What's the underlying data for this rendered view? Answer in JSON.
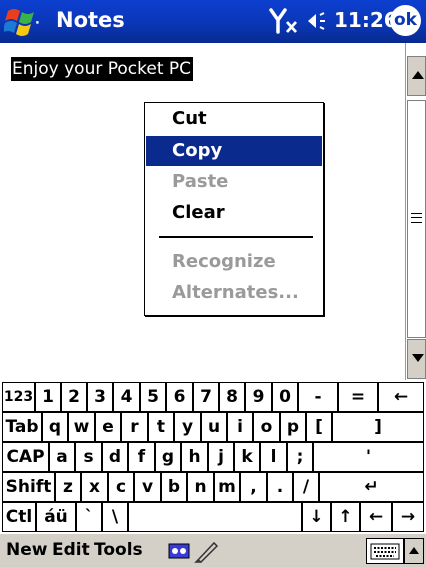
{
  "titlebar": {
    "title": "Notes",
    "time": "11:26",
    "ok_label": "ok",
    "start_icon": "windows-flag-icon",
    "signal_icon": "no-signal-icon",
    "volume_icon": "speaker-icon",
    "color": "#0a36b4"
  },
  "note": {
    "selected_text": "Enjoy your Pocket PC"
  },
  "context_menu": {
    "items": [
      {
        "label": "Cut",
        "state": "enabled"
      },
      {
        "label": "Copy",
        "state": "selected"
      },
      {
        "label": "Paste",
        "state": "disabled"
      },
      {
        "label": "Clear",
        "state": "enabled"
      },
      {
        "label": "Recognize",
        "state": "disabled"
      },
      {
        "label": "Alternates...",
        "state": "disabled"
      }
    ]
  },
  "keyboard": {
    "rows": [
      [
        "123",
        "1",
        "2",
        "3",
        "4",
        "5",
        "6",
        "7",
        "8",
        "9",
        "0",
        "-",
        "=",
        "←"
      ],
      [
        "Tab",
        "q",
        "w",
        "e",
        "r",
        "t",
        "y",
        "u",
        "i",
        "o",
        "p",
        "[",
        "]"
      ],
      [
        "CAP",
        "a",
        "s",
        "d",
        "f",
        "g",
        "h",
        "j",
        "k",
        "l",
        ";",
        "'"
      ],
      [
        "Shift",
        "z",
        "x",
        "c",
        "v",
        "b",
        "n",
        "m",
        ",",
        ".",
        "/",
        "↵"
      ],
      [
        "Ctl",
        "áü",
        "`",
        "\\",
        "",
        "↓",
        "↑",
        "←",
        "→"
      ]
    ]
  },
  "menubar": {
    "new_label": "New",
    "edit_label": "Edit",
    "tools_label": "Tools",
    "recorder_icon": "tape-recorder-icon",
    "pen_icon": "pen-icon",
    "keyboard_icon": "keyboard-icon",
    "sip_arrow_icon": "up-arrow-icon"
  }
}
